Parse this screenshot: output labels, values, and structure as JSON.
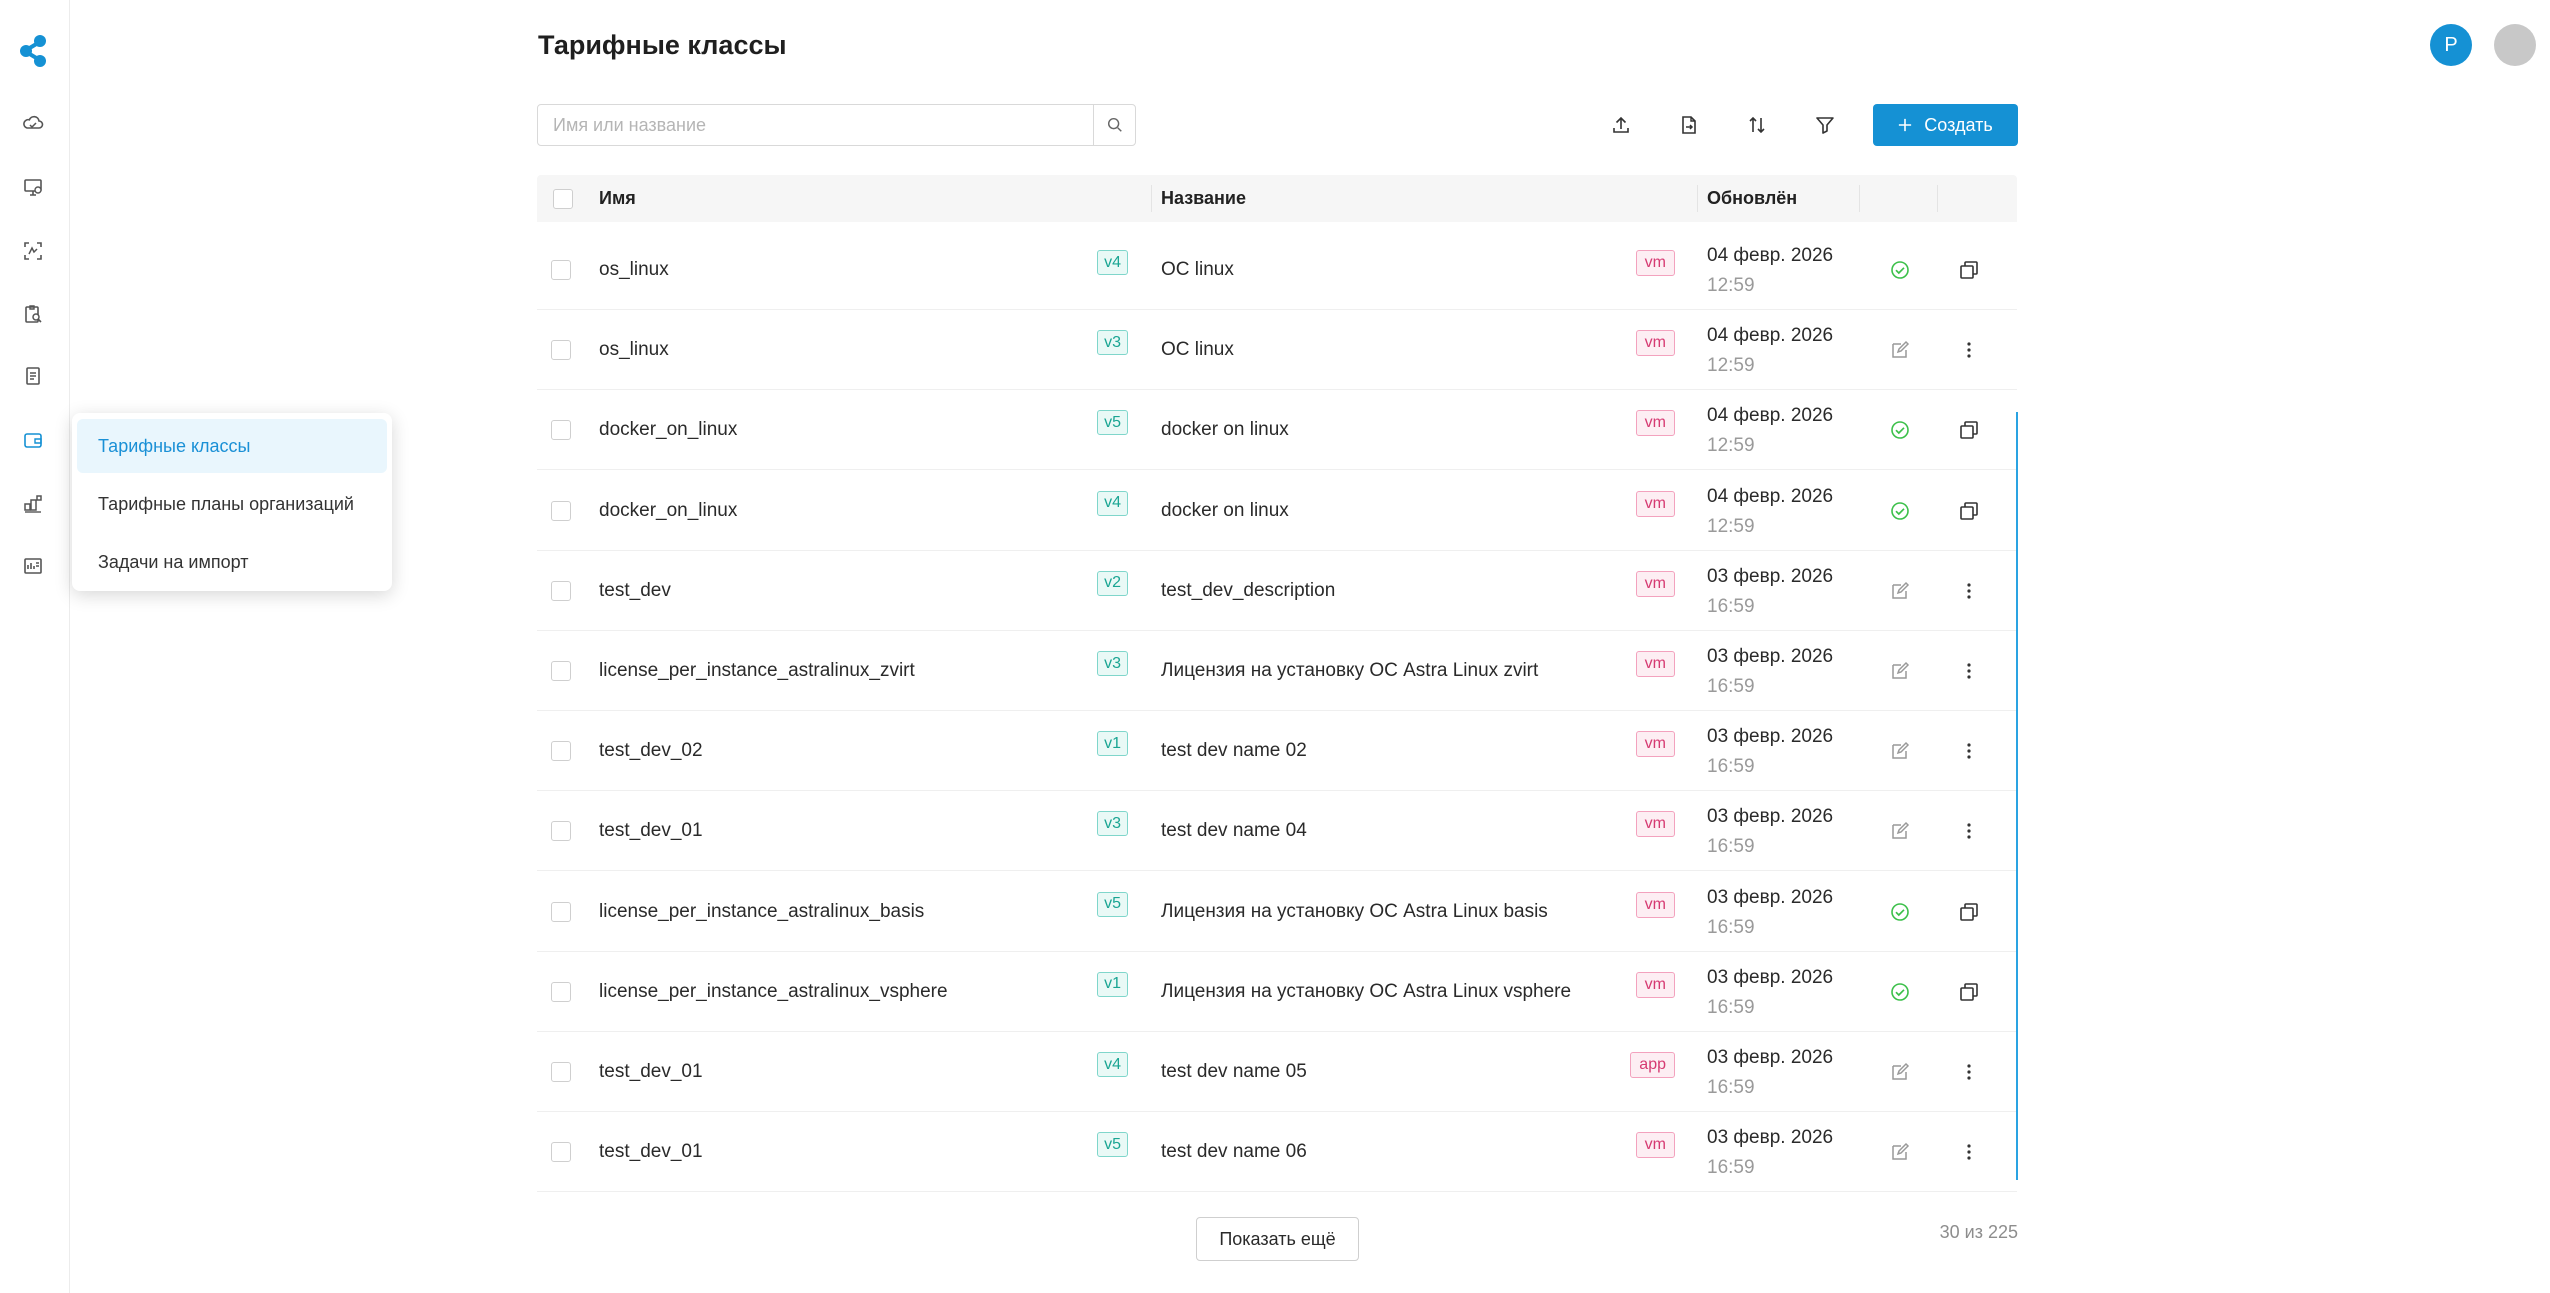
{
  "page": {
    "title": "Тарифные классы"
  },
  "user": {
    "avatar_letter": "Р"
  },
  "search": {
    "placeholder": "Имя или название"
  },
  "toolbar": {
    "create_label": "Создать"
  },
  "menu": {
    "items": [
      {
        "label": "Тарифные классы",
        "active": true
      },
      {
        "label": "Тарифные планы организаций",
        "active": false
      },
      {
        "label": "Задачи на импорт",
        "active": false
      }
    ]
  },
  "table": {
    "columns": {
      "name": "Имя",
      "title": "Название",
      "updated": "Обновлён"
    },
    "rows": [
      {
        "name": "os_linux",
        "version": "v4",
        "title": "ОС linux",
        "type": "vm",
        "date": "04 февр. 2026",
        "time": "12:59",
        "status": "published"
      },
      {
        "name": "os_linux",
        "version": "v3",
        "title": "ОС linux",
        "type": "vm",
        "date": "04 февр. 2026",
        "time": "12:59",
        "status": "draft"
      },
      {
        "name": "docker_on_linux",
        "version": "v5",
        "title": "docker on linux",
        "type": "vm",
        "date": "04 февр. 2026",
        "time": "12:59",
        "status": "published"
      },
      {
        "name": "docker_on_linux",
        "version": "v4",
        "title": "docker on linux",
        "type": "vm",
        "date": "04 февр. 2026",
        "time": "12:59",
        "status": "published"
      },
      {
        "name": "test_dev",
        "version": "v2",
        "title": "test_dev_description",
        "type": "vm",
        "date": "03 февр. 2026",
        "time": "16:59",
        "status": "draft"
      },
      {
        "name": "license_per_instance_astralinux_zvirt",
        "version": "v3",
        "title": "Лицензия на установку ОС Astra Linux zvirt",
        "type": "vm",
        "date": "03 февр. 2026",
        "time": "16:59",
        "status": "draft"
      },
      {
        "name": "test_dev_02",
        "version": "v1",
        "title": "test dev name 02",
        "type": "vm",
        "date": "03 февр. 2026",
        "time": "16:59",
        "status": "draft"
      },
      {
        "name": "test_dev_01",
        "version": "v3",
        "title": "test dev name 04",
        "type": "vm",
        "date": "03 февр. 2026",
        "time": "16:59",
        "status": "draft"
      },
      {
        "name": "license_per_instance_astralinux_basis",
        "version": "v5",
        "title": "Лицензия на установку ОС Astra Linux basis",
        "type": "vm",
        "date": "03 февр. 2026",
        "time": "16:59",
        "status": "published"
      },
      {
        "name": "license_per_instance_astralinux_vsphere",
        "version": "v1",
        "title": "Лицензия на установку ОС Astra Linux vsphere",
        "type": "vm",
        "date": "03 февр. 2026",
        "time": "16:59",
        "status": "published"
      },
      {
        "name": "test_dev_01",
        "version": "v4",
        "title": "test dev name 05",
        "type": "app",
        "date": "03 февр. 2026",
        "time": "16:59",
        "status": "draft"
      },
      {
        "name": "test_dev_01",
        "version": "v5",
        "title": "test dev name 06",
        "type": "vm",
        "date": "03 февр. 2026",
        "time": "16:59",
        "status": "draft"
      }
    ]
  },
  "footer": {
    "more_label": "Показать ещё",
    "count": "30 из 225"
  },
  "colors": {
    "accent": "#1591d4",
    "version_badge": "#1aa593",
    "type_badge": "#d63a72",
    "success": "#3cc04a"
  }
}
